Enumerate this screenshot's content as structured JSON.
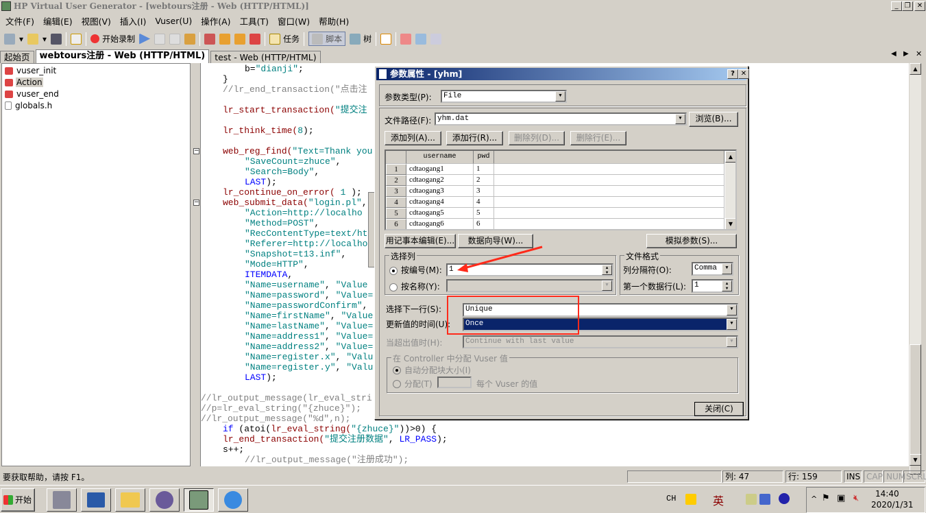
{
  "window": {
    "title": "HP Virtual User Generator - [webtours注册 - Web (HTTP/HTML)]"
  },
  "menu": [
    "文件(F)",
    "编辑(E)",
    "视图(V)",
    "插入(I)",
    "Vuser(U)",
    "操作(A)",
    "工具(T)",
    "窗口(W)",
    "帮助(H)"
  ],
  "toolbar": {
    "record": "开始录制",
    "tasks": "任务",
    "script": "脚本",
    "tree": "树"
  },
  "tabs": [
    {
      "label": "起始页"
    },
    {
      "label": "webtours注册 - Web (HTTP/HTML)",
      "active": true
    },
    {
      "label": "test - Web (HTTP/HTML)"
    }
  ],
  "tree": {
    "items": [
      {
        "label": "vuser_init",
        "icon": "action-icon"
      },
      {
        "label": "Action",
        "icon": "action-icon",
        "selected": true
      },
      {
        "label": "vuser_end",
        "icon": "action-icon"
      },
      {
        "label": "globals.h",
        "icon": "file-icon"
      }
    ]
  },
  "code": {
    "lines": [
      {
        "indent": 2,
        "segs": [
          [
            "b=",
            "plain"
          ],
          [
            "\"dianji\"",
            "str"
          ],
          [
            ";",
            "plain"
          ]
        ]
      },
      {
        "indent": 1,
        "segs": [
          [
            "}",
            "plain"
          ]
        ]
      },
      {
        "indent": 1,
        "segs": [
          [
            "//lr_end_transaction(\"点击注",
            "comment"
          ]
        ]
      },
      {
        "indent": 1,
        "segs": []
      },
      {
        "indent": 1,
        "segs": [
          [
            "lr_start_transaction(",
            "func"
          ],
          [
            "\"提交注",
            "str"
          ]
        ]
      },
      {
        "indent": 1,
        "segs": []
      },
      {
        "indent": 1,
        "segs": [
          [
            "lr_think_time(",
            "func"
          ],
          [
            "8",
            "str"
          ],
          [
            ");",
            "plain"
          ]
        ]
      },
      {
        "indent": 1,
        "segs": []
      },
      {
        "indent": 1,
        "segs": [
          [
            "web_reg_find(",
            "func"
          ],
          [
            "\"Text=Thank you",
            "str"
          ]
        ],
        "fold": true
      },
      {
        "indent": 2,
        "segs": [
          [
            "\"SaveCount=zhuce\"",
            "str"
          ],
          [
            ",",
            "plain"
          ]
        ]
      },
      {
        "indent": 2,
        "segs": [
          [
            "\"Search=Body\"",
            "str"
          ],
          [
            ",",
            "plain"
          ]
        ]
      },
      {
        "indent": 2,
        "segs": [
          [
            "LAST",
            "kw"
          ],
          [
            ");",
            "plain"
          ]
        ]
      },
      {
        "indent": 1,
        "segs": [
          [
            "lr_continue_on_error( ",
            "func"
          ],
          [
            "1",
            "str"
          ],
          [
            " );",
            "plain"
          ]
        ]
      },
      {
        "indent": 1,
        "segs": [
          [
            "web_submit_data(",
            "func"
          ],
          [
            "\"login.pl\"",
            "str"
          ],
          [
            ",",
            "plain"
          ]
        ],
        "fold": true
      },
      {
        "indent": 2,
        "segs": [
          [
            "\"Action=http://localho",
            "str"
          ]
        ]
      },
      {
        "indent": 2,
        "segs": [
          [
            "\"Method=POST\"",
            "str"
          ],
          [
            ",",
            "plain"
          ]
        ]
      },
      {
        "indent": 2,
        "segs": [
          [
            "\"RecContentType=text/ht",
            "str"
          ]
        ]
      },
      {
        "indent": 2,
        "segs": [
          [
            "\"Referer=http://localho",
            "str"
          ]
        ]
      },
      {
        "indent": 2,
        "segs": [
          [
            "\"Snapshot=t13.inf\"",
            "str"
          ],
          [
            ",",
            "plain"
          ]
        ]
      },
      {
        "indent": 2,
        "segs": [
          [
            "\"Mode=HTTP\"",
            "str"
          ],
          [
            ",",
            "plain"
          ]
        ]
      },
      {
        "indent": 2,
        "segs": [
          [
            "ITEMDATA",
            "kw"
          ],
          [
            ",",
            "plain"
          ]
        ]
      },
      {
        "indent": 2,
        "segs": [
          [
            "\"Name=username\"",
            "str"
          ],
          [
            ", ",
            "plain"
          ],
          [
            "\"Value",
            "str"
          ]
        ]
      },
      {
        "indent": 2,
        "segs": [
          [
            "\"Name=password\"",
            "str"
          ],
          [
            ", ",
            "plain"
          ],
          [
            "\"Value=",
            "str"
          ]
        ]
      },
      {
        "indent": 2,
        "segs": [
          [
            "\"Name=passwordConfirm\"",
            "str"
          ],
          [
            ",",
            "plain"
          ]
        ]
      },
      {
        "indent": 2,
        "segs": [
          [
            "\"Name=firstName\"",
            "str"
          ],
          [
            ", ",
            "plain"
          ],
          [
            "\"Value",
            "str"
          ]
        ]
      },
      {
        "indent": 2,
        "segs": [
          [
            "\"Name=lastName\"",
            "str"
          ],
          [
            ", ",
            "plain"
          ],
          [
            "\"Value=",
            "str"
          ]
        ]
      },
      {
        "indent": 2,
        "segs": [
          [
            "\"Name=address1\"",
            "str"
          ],
          [
            ", ",
            "plain"
          ],
          [
            "\"Value=",
            "str"
          ]
        ]
      },
      {
        "indent": 2,
        "segs": [
          [
            "\"Name=address2\"",
            "str"
          ],
          [
            ", ",
            "plain"
          ],
          [
            "\"Value=",
            "str"
          ]
        ]
      },
      {
        "indent": 2,
        "segs": [
          [
            "\"Name=register.x\"",
            "str"
          ],
          [
            ", ",
            "plain"
          ],
          [
            "\"Valu",
            "str"
          ]
        ]
      },
      {
        "indent": 2,
        "segs": [
          [
            "\"Name=register.y\"",
            "str"
          ],
          [
            ", ",
            "plain"
          ],
          [
            "\"Valu",
            "str"
          ]
        ]
      },
      {
        "indent": 2,
        "segs": [
          [
            "LAST",
            "kw"
          ],
          [
            ");",
            "plain"
          ]
        ]
      },
      {
        "indent": 0,
        "segs": []
      },
      {
        "indent": 0,
        "segs": [
          [
            "//lr_output_message(lr_eval_stri",
            "comment"
          ]
        ]
      },
      {
        "indent": 0,
        "segs": [
          [
            "//p=lr_eval_string(\"{zhuce}\");",
            "comment"
          ]
        ]
      },
      {
        "indent": 0,
        "segs": [
          [
            "//lr_output_message(\"%d\",n);",
            "comment"
          ]
        ]
      },
      {
        "indent": 1,
        "segs": [
          [
            "if",
            "kw"
          ],
          [
            " (atoi(",
            "plain"
          ],
          [
            "lr_eval_string(",
            "func"
          ],
          [
            "\"{zhuce}\"",
            "str"
          ],
          [
            "))>0) {",
            "plain"
          ]
        ]
      },
      {
        "indent": 1,
        "segs": [
          [
            "lr_end_transaction(",
            "func"
          ],
          [
            "\"提交注册数据\"",
            "str"
          ],
          [
            ", ",
            "plain"
          ],
          [
            "LR_PASS",
            "kw"
          ],
          [
            ");",
            "plain"
          ]
        ]
      },
      {
        "indent": 1,
        "segs": [
          [
            "s++;",
            "plain"
          ]
        ]
      },
      {
        "indent": 2,
        "segs": [
          [
            "//lr_output_message(\"注册成功\");",
            "comment"
          ]
        ]
      }
    ]
  },
  "dialog": {
    "title": "参数属性 - [yhm]",
    "help": "?",
    "close": "✕",
    "param_type_label": "参数类型(P):",
    "param_type": "File",
    "file_path_label": "文件路径(F):",
    "file_path": "yhm.dat",
    "browse": "浏览(B)...",
    "add_col": "添加列(A)...",
    "add_row": "添加行(R)...",
    "del_col": "删除列(D)...",
    "del_row": "删除行(E)...",
    "grid": {
      "columns": [
        "username",
        "pwd"
      ],
      "rows": [
        [
          "1",
          "cdtaogang1",
          "1"
        ],
        [
          "2",
          "cdtaogang2",
          "2"
        ],
        [
          "3",
          "cdtaogang3",
          "3"
        ],
        [
          "4",
          "cdtaogang4",
          "4"
        ],
        [
          "5",
          "cdtaogang5",
          "5"
        ],
        [
          "6",
          "cdtaogang6",
          "6"
        ]
      ]
    },
    "notepad": "用记事本编辑(E)...",
    "wizard": "数据向导(W)...",
    "simulate": "模拟参数(S)...",
    "select_col": {
      "title": "选择列",
      "by_number": "按编号(M):",
      "number": "1",
      "by_name": "按名称(Y):"
    },
    "file_format": {
      "title": "文件格式",
      "delimiter_label": "列分隔符(O):",
      "delimiter": "Comma",
      "first_row_label": "第一个数据行(L):",
      "first_row": "1"
    },
    "next_row_label": "选择下一行(S):",
    "next_row": "Unique",
    "update_label": "更新值的时间(U):",
    "update": "Once",
    "out_of_values_label": "当超出值时(H):",
    "out_of_values": "Continue with last value",
    "controller": {
      "title": "在 Controller 中分配 Vuser 值",
      "auto": "自动分配块大小(I)",
      "alloc": "分配(T)",
      "per_vuser": "每个 Vuser 的值"
    },
    "close_btn": "关闭(C)",
    "annotation_color": "#ff2a1a"
  },
  "status": {
    "help": "要获取帮助，请按 F1。",
    "col": "列: 47",
    "row": "行: 159",
    "ins": "INS",
    "cap": "CAP",
    "num": "NUM",
    "scrl": "SCRL"
  },
  "taskbar": {
    "start": "开始",
    "lang": "CH",
    "ime": "英",
    "time": "14:40",
    "date": "2020/1/31"
  }
}
